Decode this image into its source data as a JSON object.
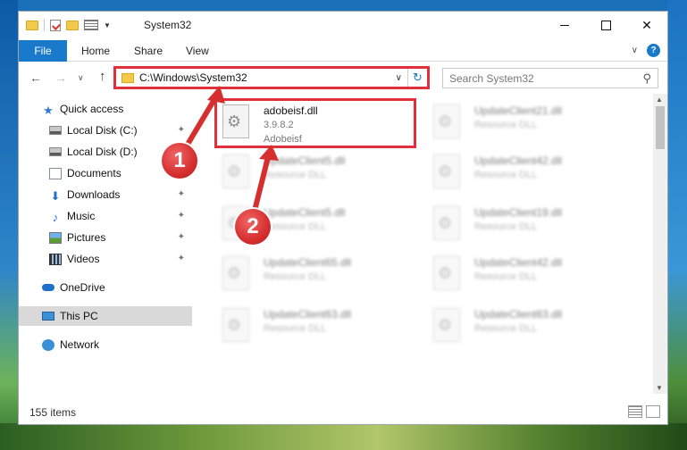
{
  "window": {
    "title": "System32",
    "controls": {
      "minimize_icon": "minimize-icon",
      "maximize_icon": "maximize-icon",
      "close": "✕"
    }
  },
  "ribbon": {
    "tabs": [
      "File",
      "Home",
      "Share",
      "View"
    ],
    "help": "?"
  },
  "address": {
    "path": "C:\\Windows\\System32",
    "search_placeholder": "Search System32"
  },
  "sidebar": {
    "items": [
      {
        "label": "Quick access",
        "icon": "star-icon",
        "pinned": false
      },
      {
        "label": "Local Disk (C:)",
        "icon": "drive-icon",
        "pinned": true
      },
      {
        "label": "Local Disk (D:)",
        "icon": "drive-icon",
        "pinned": false
      },
      {
        "label": "Documents",
        "icon": "documents-icon",
        "pinned": true
      },
      {
        "label": "Downloads",
        "icon": "download-icon",
        "pinned": true
      },
      {
        "label": "Music",
        "icon": "music-icon",
        "pinned": true
      },
      {
        "label": "Pictures",
        "icon": "pictures-icon",
        "pinned": true
      },
      {
        "label": "Videos",
        "icon": "videos-icon",
        "pinned": true
      },
      {
        "label": "OneDrive",
        "icon": "cloud-icon",
        "pinned": false
      },
      {
        "label": "This PC",
        "icon": "pc-icon",
        "pinned": false,
        "selected": true
      },
      {
        "label": "Network",
        "icon": "network-icon",
        "pinned": false
      }
    ]
  },
  "files": [
    {
      "name": "adobeisf.dll",
      "line2": "3.9.8.2",
      "line3": "Adobeisf",
      "highlighted": true
    },
    {
      "name": "UpdateClient21.dll",
      "line2": "Resource DLL"
    },
    {
      "name": "UpdateClient5.dll",
      "line2": "Resource DLL"
    },
    {
      "name": "UpdateClient42.dll",
      "line2": "Resource DLL"
    },
    {
      "name": "UpdateClient5.dll",
      "line2": "Resource DLL"
    },
    {
      "name": "UpdateClient19.dll",
      "line2": "Resource DLL"
    },
    {
      "name": "UpdateClient65.dll",
      "line2": "Resource DLL"
    },
    {
      "name": "UpdateClient42.dll",
      "line2": "Resource DLL"
    },
    {
      "name": "UpdateClient63.dll",
      "line2": "Resource DLL"
    },
    {
      "name": "UpdateClient63.dll",
      "line2": "Resource DLL"
    }
  ],
  "status": {
    "item_count": "155 items"
  },
  "annotations": {
    "marker1": "1",
    "marker2": "2",
    "color": "#e1303b"
  }
}
